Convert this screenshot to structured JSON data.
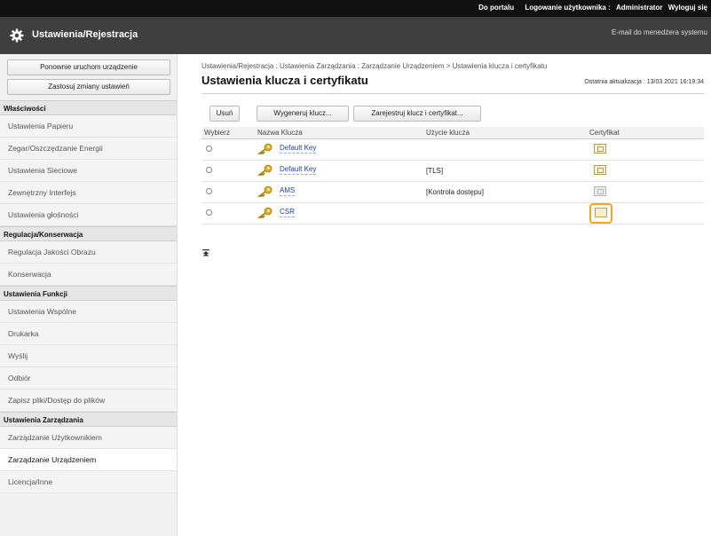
{
  "topbar": {
    "portal": "Do portalu",
    "login_label": "Logowanie użytkownika :",
    "user": "Administrator",
    "logout": "Wyloguj się"
  },
  "header": {
    "title": "Ustawienia/Rejestracja",
    "mail_link": "E-mail do menedżera systemu",
    "icon": "gear-icon"
  },
  "sidebar": {
    "buttons": [
      "Ponownie uruchom urządzenie",
      "Zastosuj zmiany ustawień"
    ],
    "sections": [
      {
        "title": "Właściwości",
        "items": [
          "Ustawienia Papieru",
          "Zegar/Oszczędzanie Energii",
          "Ustawienia Sieciowe",
          "Zewnętrzny Interfejs",
          "Ustawienia głośności"
        ]
      },
      {
        "title": "Regulacja/Konserwacja",
        "items": [
          "Regulacja Jakości Obrazu",
          "Konserwacja"
        ]
      },
      {
        "title": "Ustawienia Funkcji",
        "items": [
          "Ustawienia Wspólne",
          "Drukarka",
          "Wyślij",
          "Odbiór",
          "Zapisz pliki/Dostęp do plików"
        ]
      },
      {
        "title": "Ustawienia Zarządzania",
        "items": [
          "Zarządzanie Użytkownikiem",
          "Zarządzanie Urządzeniem",
          "Licencja/Inne"
        ]
      }
    ],
    "active_item": "Zarządzanie Urządzeniem"
  },
  "main": {
    "breadcrumb": "Ustawienia/Rejestracja : Ustawienia Zarządzania : Zarządzanie Urządzeniem > Ustawienia klucza i certyfikatu",
    "title": "Ustawienia klucza i certyfikatu",
    "last_update": "Ostatnia aktualizacja : 13/03 2021 16:19:34",
    "toolbar": {
      "delete": "Usuń",
      "generate": "Wygeneruj klucz...",
      "register": "Zarejestruj klucz i certyfikat..."
    },
    "table": {
      "headers": [
        "Wybierz",
        "Nazwa Klucza",
        "Użycie klucza",
        "Certyfikat"
      ],
      "rows": [
        {
          "name": "Default Key",
          "usage": "",
          "cert": "certificate-icon"
        },
        {
          "name": "Default Key",
          "usage": "[TLS]",
          "cert": "certificate-icon"
        },
        {
          "name": "AMS",
          "usage": "[Kontrola dostępu]",
          "cert": "certificate-icon-disabled"
        },
        {
          "name": "CSR",
          "usage": "",
          "cert": "csr-certificate-icon"
        }
      ]
    }
  },
  "colors": {
    "topbar": "#111111",
    "header": "#3f3f3f",
    "link": "#1d3f9c",
    "highlight": "#f3a622"
  }
}
